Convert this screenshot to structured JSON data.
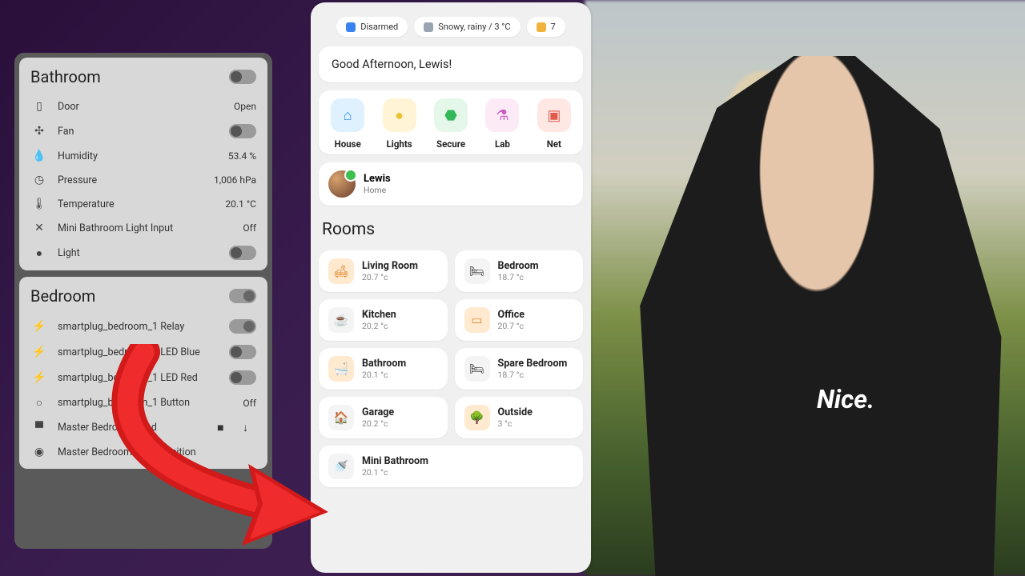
{
  "shirt": "Nice.",
  "old": {
    "sections": [
      {
        "title": "Bathroom",
        "header_toggle": false,
        "rows": [
          {
            "icon": "door-icon",
            "glyph": "▯",
            "label": "Door",
            "value": "Open",
            "type": "value"
          },
          {
            "icon": "fan-icon",
            "glyph": "✣",
            "label": "Fan",
            "type": "toggle",
            "on": false
          },
          {
            "icon": "humidity-icon",
            "glyph": "💧",
            "label": "Humidity",
            "value": "53.4 %",
            "type": "value"
          },
          {
            "icon": "pressure-icon",
            "glyph": "◷",
            "label": "Pressure",
            "value": "1,006 hPa",
            "type": "value"
          },
          {
            "icon": "temperature-icon",
            "glyph": "🌡",
            "label": "Temperature",
            "value": "20.1 °C",
            "type": "value"
          },
          {
            "icon": "input-off-icon",
            "glyph": "✕",
            "label": "Mini Bathroom Light Input",
            "value": "Off",
            "type": "value"
          },
          {
            "icon": "light-icon",
            "glyph": "●",
            "label": "Light",
            "type": "toggle",
            "on": false
          }
        ]
      },
      {
        "title": "Bedroom",
        "header_toggle": true,
        "rows": [
          {
            "icon": "plug-icon",
            "glyph": "⚡",
            "label": "smartplug_bedroom_1 Relay",
            "type": "toggle",
            "on": true
          },
          {
            "icon": "plug-icon",
            "glyph": "⚡",
            "label": "smartplug_bedroom_1 LED Blue",
            "type": "toggle",
            "on": false
          },
          {
            "icon": "plug-icon",
            "glyph": "⚡",
            "label": "smartplug_bedroom_1 LED Red",
            "type": "toggle",
            "on": false
          },
          {
            "icon": "circle-icon",
            "glyph": "○",
            "label": "smartplug_bedroom_1 Button",
            "value": "Off",
            "type": "value"
          },
          {
            "icon": "blind-icon",
            "glyph": "▀",
            "label": "Master Bedroom Blind",
            "type": "blind"
          },
          {
            "icon": "eye-icon",
            "glyph": "◉",
            "label": "Master Bedroom Blind Position",
            "value": "",
            "type": "value"
          }
        ]
      }
    ]
  },
  "phone": {
    "chips": [
      {
        "icon": "shield-icon",
        "color": "#3a82f0",
        "label": "Disarmed"
      },
      {
        "icon": "weather-icon",
        "color": "#9aa5b1",
        "label": "Snowy, rainy / 3 °C"
      },
      {
        "icon": "bulb-icon",
        "color": "#f2b23e",
        "label": "7"
      }
    ],
    "greeting": "Good Afternoon, Lewis!",
    "tiles": [
      {
        "name": "House",
        "icon": "house-icon",
        "glyph": "⌂",
        "bg": "#dff1ff",
        "fg": "#2f8fe8"
      },
      {
        "name": "Lights",
        "icon": "bulb-icon",
        "glyph": "●",
        "bg": "#fff4d6",
        "fg": "#e9c233"
      },
      {
        "name": "Secure",
        "icon": "shield-icon",
        "glyph": "⬣",
        "bg": "#e4f7e9",
        "fg": "#33b85a"
      },
      {
        "name": "Lab",
        "icon": "flask-icon",
        "glyph": "⚗",
        "bg": "#fceaf6",
        "fg": "#c95cc0"
      },
      {
        "name": "Net",
        "icon": "net-icon",
        "glyph": "▣",
        "bg": "#ffe7e4",
        "fg": "#e05b4c"
      }
    ],
    "user": {
      "name": "Lewis",
      "location": "Home"
    },
    "rooms_heading": "Rooms",
    "rooms": [
      {
        "name": "Living Room",
        "temp": "20.7 °c",
        "glyph": "🛋",
        "warm": true
      },
      {
        "name": "Bedroom",
        "temp": "18.7 °c",
        "glyph": "🛏",
        "warm": false
      },
      {
        "name": "Kitchen",
        "temp": "20.2 °c",
        "glyph": "☕",
        "warm": false
      },
      {
        "name": "Office",
        "temp": "20.7 °c",
        "glyph": "▭",
        "warm": true
      },
      {
        "name": "Bathroom",
        "temp": "20.1 °c",
        "glyph": "🛁",
        "warm": true
      },
      {
        "name": "Spare Bedroom",
        "temp": "18.7 °c",
        "glyph": "🛏",
        "warm": false
      },
      {
        "name": "Garage",
        "temp": "20.2 °c",
        "glyph": "🏠",
        "warm": false
      },
      {
        "name": "Outside",
        "temp": "3 °c",
        "glyph": "🌳",
        "warm": true
      },
      {
        "name": "Mini Bathroom",
        "temp": "20.1 °c",
        "glyph": "🚿",
        "warm": false,
        "full": true
      }
    ]
  }
}
